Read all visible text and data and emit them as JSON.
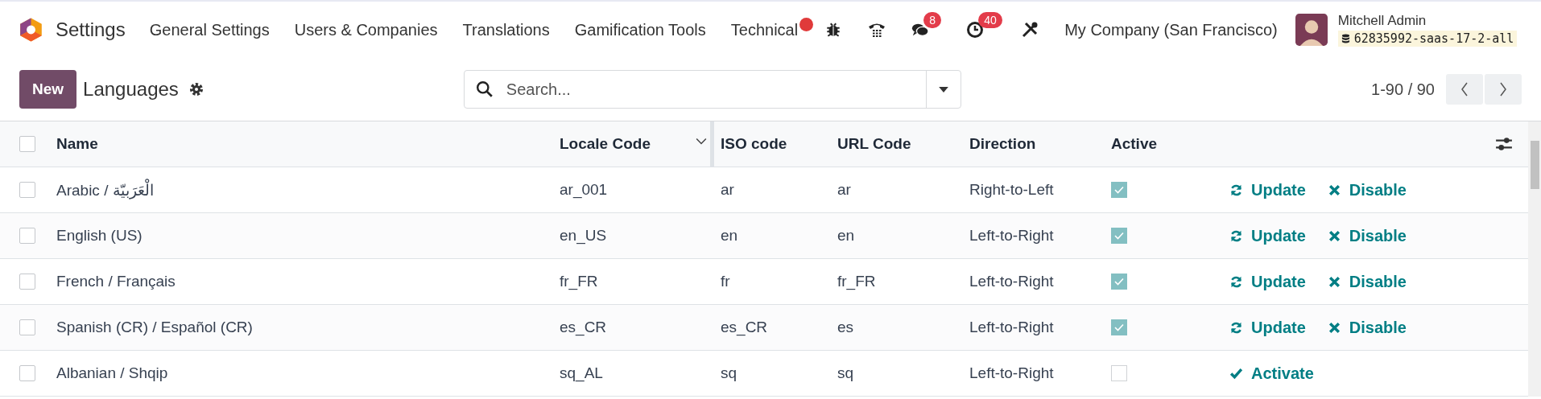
{
  "navbar": {
    "app_name": "Settings",
    "menu": [
      "General Settings",
      "Users & Companies",
      "Translations",
      "Gamification Tools",
      "Technical"
    ],
    "message_count": "8",
    "activity_count": "40",
    "company": "My Company (San Francisco)",
    "user": {
      "name": "Mitchell Admin",
      "database": "62835992-saas-17-2-all"
    }
  },
  "control_panel": {
    "new_button": "New",
    "title": "Languages",
    "search": {
      "placeholder": "Search..."
    },
    "pager": "1-90 / 90"
  },
  "table": {
    "select_all": false,
    "columns": [
      "Name",
      "Locale Code",
      "ISO code",
      "URL Code",
      "Direction",
      "Active"
    ],
    "rows": [
      {
        "selected": false,
        "cells": [
          "Arabic / الْعَرَبيّة",
          "ar_001",
          "ar",
          "ar",
          "Right-to-Left"
        ],
        "active": true,
        "actions": [
          {
            "kind": "update",
            "label": "Update"
          },
          {
            "kind": "disable",
            "label": "Disable"
          }
        ]
      },
      {
        "selected": false,
        "cells": [
          "English (US)",
          "en_US",
          "en",
          "en",
          "Left-to-Right"
        ],
        "active": true,
        "actions": [
          {
            "kind": "update",
            "label": "Update"
          },
          {
            "kind": "disable",
            "label": "Disable"
          }
        ]
      },
      {
        "selected": false,
        "cells": [
          "French / Français",
          "fr_FR",
          "fr",
          "fr_FR",
          "Left-to-Right"
        ],
        "active": true,
        "actions": [
          {
            "kind": "update",
            "label": "Update"
          },
          {
            "kind": "disable",
            "label": "Disable"
          }
        ]
      },
      {
        "selected": false,
        "cells": [
          "Spanish (CR) / Español (CR)",
          "es_CR",
          "es_CR",
          "es",
          "Left-to-Right"
        ],
        "active": true,
        "actions": [
          {
            "kind": "update",
            "label": "Update"
          },
          {
            "kind": "disable",
            "label": "Disable"
          }
        ]
      },
      {
        "selected": false,
        "cells": [
          "Albanian / Shqip",
          "sq_AL",
          "sq",
          "sq",
          "Left-to-Right"
        ],
        "active": false,
        "actions": [
          {
            "kind": "activate",
            "label": "Activate"
          }
        ]
      }
    ]
  }
}
